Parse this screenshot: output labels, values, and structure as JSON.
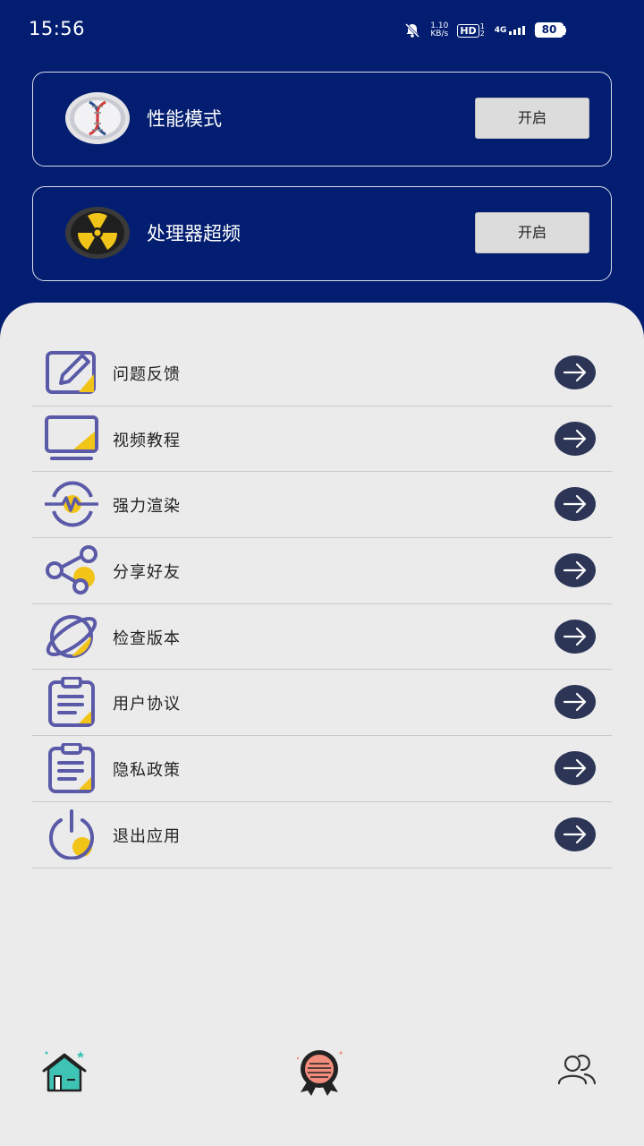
{
  "status_bar": {
    "time": "15:56",
    "net_speed_value": "1.10",
    "net_speed_unit": "KB/s",
    "hd_label": "HD",
    "hd_sub": "1 2",
    "signal1_label": "4G",
    "signal2_label": "4G",
    "battery": "80"
  },
  "mode_cards": [
    {
      "title": "性能模式",
      "button": "开启",
      "icon": "dna-icon"
    },
    {
      "title": "处理器超频",
      "button": "开启",
      "icon": "radiation-icon"
    }
  ],
  "menu": {
    "items": [
      {
        "label": "问题反馈",
        "icon": "edit-icon"
      },
      {
        "label": "视频教程",
        "icon": "monitor-icon"
      },
      {
        "label": "强力渲染",
        "icon": "pulse-icon"
      },
      {
        "label": "分享好友",
        "icon": "share-icon"
      },
      {
        "label": "检查版本",
        "icon": "planet-icon"
      },
      {
        "label": "用户协议",
        "icon": "clipboard-icon"
      },
      {
        "label": "隐私政策",
        "icon": "clipboard-icon"
      },
      {
        "label": "退出应用",
        "icon": "power-icon"
      }
    ]
  },
  "bottom_nav": {
    "items": [
      {
        "icon": "home-icon"
      },
      {
        "icon": "award-icon"
      },
      {
        "icon": "users-icon"
      }
    ]
  },
  "colors": {
    "header_bg": "#031e70",
    "panel_bg": "#ebebeb",
    "icon_purple": "#5a5aa8",
    "icon_yellow": "#f2c418",
    "arrow_bg": "#2d3557"
  }
}
